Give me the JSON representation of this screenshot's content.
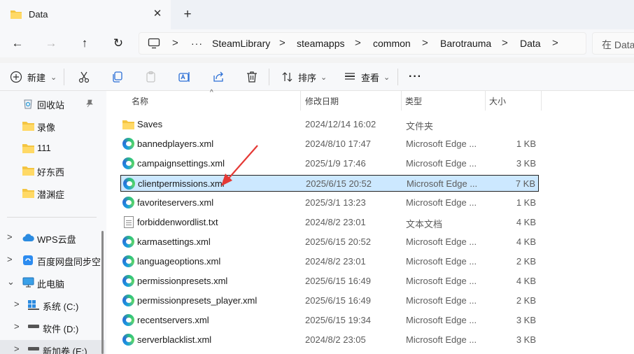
{
  "tab": {
    "title": "Data",
    "close_glyph": "✕",
    "new_tab_glyph": "+"
  },
  "nav": {
    "back": "←",
    "forward": "→",
    "up": "↑",
    "refresh": "↻"
  },
  "address": {
    "more": "···",
    "separator": ">",
    "crumbs": [
      "SteamLibrary",
      "steamapps",
      "common",
      "Barotrauma",
      "Data"
    ]
  },
  "search": {
    "placeholder": "在 Data"
  },
  "toolbar": {
    "new_label": "新建",
    "sort_label": "排序",
    "view_label": "查看",
    "more_glyph": "···",
    "dropdown_glyph": "⌄"
  },
  "sidebar": {
    "quick_access": [
      {
        "label": "回收站",
        "icon": "recycle-bin-icon",
        "pinned": true
      },
      {
        "label": "录像",
        "icon": "folder-icon"
      },
      {
        "label": "111",
        "icon": "folder-icon"
      },
      {
        "label": "好东西",
        "icon": "folder-icon"
      },
      {
        "label": "潜渊症",
        "icon": "folder-icon"
      }
    ],
    "tree": [
      {
        "label": "WPS云盘",
        "icon": "cloud-icon",
        "chevron": ">"
      },
      {
        "label": "百度网盘同步空",
        "icon": "baidu-sync-icon",
        "chevron": ">"
      },
      {
        "label": "此电脑",
        "icon": "monitor-icon",
        "chevron": "⌄"
      },
      {
        "label": "系统 (C:)",
        "icon": "windows-drive-icon",
        "chevron": ">"
      },
      {
        "label": "软件 (D:)",
        "icon": "drive-icon",
        "chevron": ">"
      },
      {
        "label": "新加卷 (E:)",
        "icon": "drive-icon",
        "chevron": ">"
      }
    ]
  },
  "columns": {
    "name": "名称",
    "modified": "修改日期",
    "type": "类型",
    "size": "大小",
    "sort_glyph": "^"
  },
  "files": [
    {
      "name": "Saves",
      "modified": "2024/12/14 16:02",
      "type": "文件夹",
      "size": "",
      "icon": "folder-icon"
    },
    {
      "name": "bannedplayers.xml",
      "modified": "2024/8/10 17:47",
      "type": "Microsoft Edge ...",
      "size": "1 KB",
      "icon": "edge-icon"
    },
    {
      "name": "campaignsettings.xml",
      "modified": "2025/1/9 17:46",
      "type": "Microsoft Edge ...",
      "size": "3 KB",
      "icon": "edge-icon"
    },
    {
      "name": "clientpermissions.xml",
      "modified": "2025/6/15 20:52",
      "type": "Microsoft Edge ...",
      "size": "7 KB",
      "icon": "edge-icon",
      "selected": true
    },
    {
      "name": "favoriteservers.xml",
      "modified": "2025/3/1 13:23",
      "type": "Microsoft Edge ...",
      "size": "1 KB",
      "icon": "edge-icon"
    },
    {
      "name": "forbiddenwordlist.txt",
      "modified": "2024/8/2 23:01",
      "type": "文本文档",
      "size": "4 KB",
      "icon": "text-file-icon"
    },
    {
      "name": "karmasettings.xml",
      "modified": "2025/6/15 20:52",
      "type": "Microsoft Edge ...",
      "size": "4 KB",
      "icon": "edge-icon"
    },
    {
      "name": "languageoptions.xml",
      "modified": "2024/8/2 23:01",
      "type": "Microsoft Edge ...",
      "size": "2 KB",
      "icon": "edge-icon"
    },
    {
      "name": "permissionpresets.xml",
      "modified": "2025/6/15 16:49",
      "type": "Microsoft Edge ...",
      "size": "4 KB",
      "icon": "edge-icon"
    },
    {
      "name": "permissionpresets_player.xml",
      "modified": "2025/6/15 16:49",
      "type": "Microsoft Edge ...",
      "size": "2 KB",
      "icon": "edge-icon"
    },
    {
      "name": "recentservers.xml",
      "modified": "2025/6/15 19:34",
      "type": "Microsoft Edge ...",
      "size": "3 KB",
      "icon": "edge-icon"
    },
    {
      "name": "serverblacklist.xml",
      "modified": "2024/8/2 23:05",
      "type": "Microsoft Edge ...",
      "size": "3 KB",
      "icon": "edge-icon"
    }
  ],
  "colors": {
    "selection": "#cce8ff",
    "annotation_arrow": "#e53935",
    "folder": "#f4c542",
    "accent": "#0067c0"
  }
}
